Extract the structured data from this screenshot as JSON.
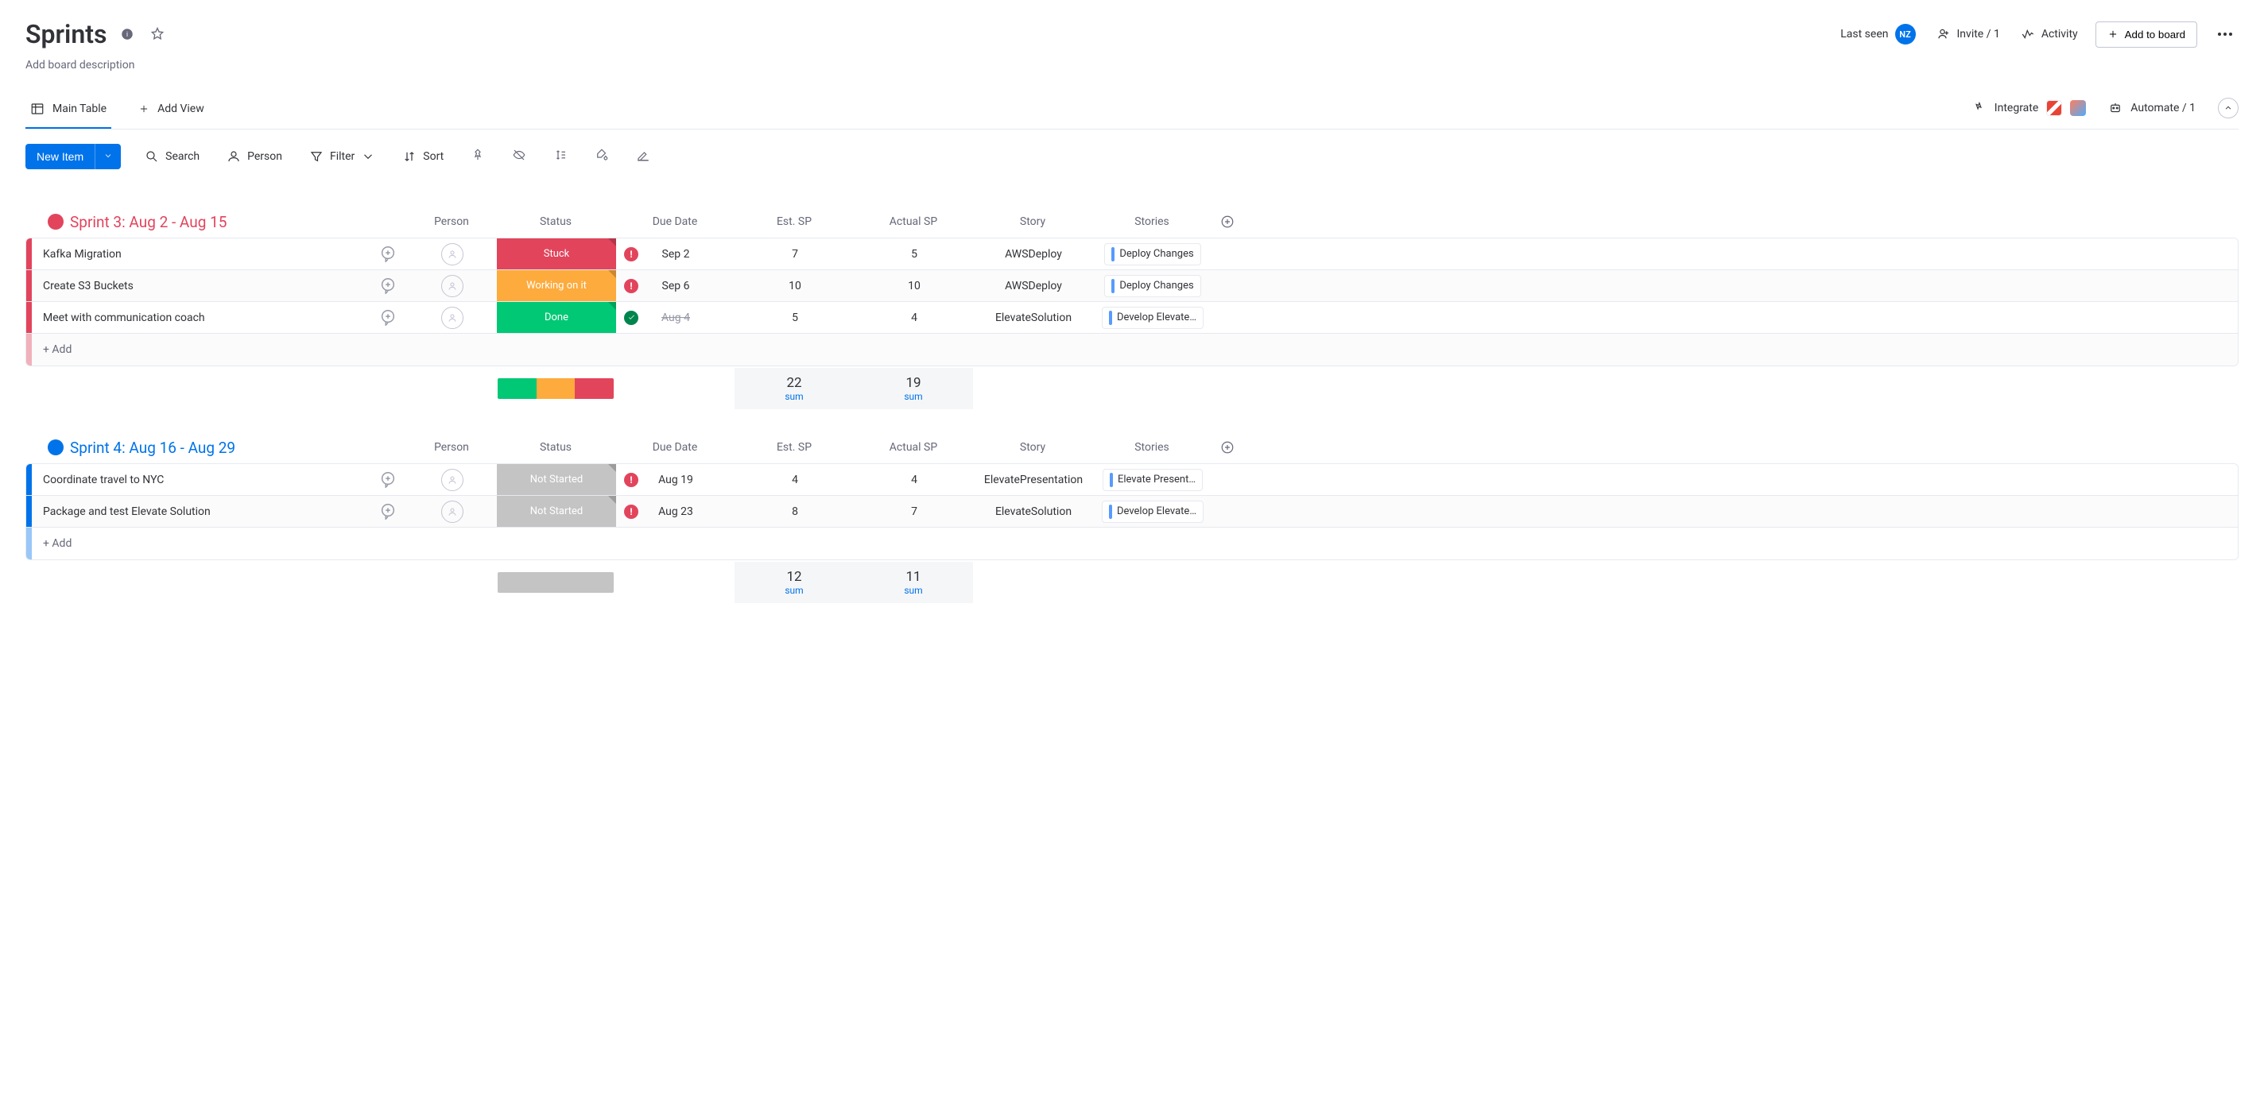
{
  "header": {
    "title": "Sprints",
    "description_placeholder": "Add board description",
    "last_seen_label": "Last seen",
    "avatar_initials": "NZ",
    "invite_label": "Invite / 1",
    "activity_label": "Activity",
    "add_to_board_label": "Add to board"
  },
  "tabs": {
    "main_table": "Main Table",
    "add_view": "Add View",
    "integrate": "Integrate",
    "automate": "Automate / 1"
  },
  "toolbar": {
    "new_item": "New Item",
    "search": "Search",
    "person": "Person",
    "filter": "Filter",
    "sort": "Sort"
  },
  "columns": [
    "Person",
    "Status",
    "Due Date",
    "Est. SP",
    "Actual SP",
    "Story",
    "Stories"
  ],
  "status_colors": {
    "Stuck": "#e2445c",
    "Working on it": "#fdab3d",
    "Done": "#00c875",
    "Not Started": "#c4c4c4"
  },
  "groups": [
    {
      "title": "Sprint 3: Aug 2 - Aug 15",
      "color": "#e2445c",
      "status_summary": [
        {
          "color": "#00c875",
          "pct": 33.3
        },
        {
          "color": "#fdab3d",
          "pct": 33.3
        },
        {
          "color": "#e2445c",
          "pct": 33.4
        }
      ],
      "sum_est": 22,
      "sum_actual": 19,
      "items": [
        {
          "name": "Kafka Migration",
          "status": "Stuck",
          "due": "Sep 2",
          "due_state": "overdue",
          "est": 7,
          "actual": 5,
          "story": "AWSDeploy",
          "stories": "Deploy Changes"
        },
        {
          "name": "Create S3 Buckets",
          "status": "Working on it",
          "due": "Sep 6",
          "due_state": "overdue",
          "est": 10,
          "actual": 10,
          "story": "AWSDeploy",
          "stories": "Deploy Changes"
        },
        {
          "name": "Meet with communication coach",
          "status": "Done",
          "due": "Aug 4",
          "due_state": "done",
          "est": 5,
          "actual": 4,
          "story": "ElevateSolution",
          "stories": "Develop Elevate…"
        }
      ]
    },
    {
      "title": "Sprint 4: Aug 16 - Aug 29",
      "color": "#0073ea",
      "status_summary": [
        {
          "color": "#c4c4c4",
          "pct": 100
        }
      ],
      "sum_est": 12,
      "sum_actual": 11,
      "items": [
        {
          "name": "Coordinate travel to NYC",
          "status": "Not Started",
          "due": "Aug 19",
          "due_state": "overdue",
          "est": 4,
          "actual": 4,
          "story": "ElevatePresentation",
          "stories": "Elevate Present…"
        },
        {
          "name": "Package and test Elevate Solution",
          "status": "Not Started",
          "due": "Aug 23",
          "due_state": "overdue",
          "est": 8,
          "actual": 7,
          "story": "ElevateSolution",
          "stories": "Develop Elevate…"
        }
      ]
    }
  ],
  "add_row_label": "+ Add",
  "sum_label": "sum"
}
